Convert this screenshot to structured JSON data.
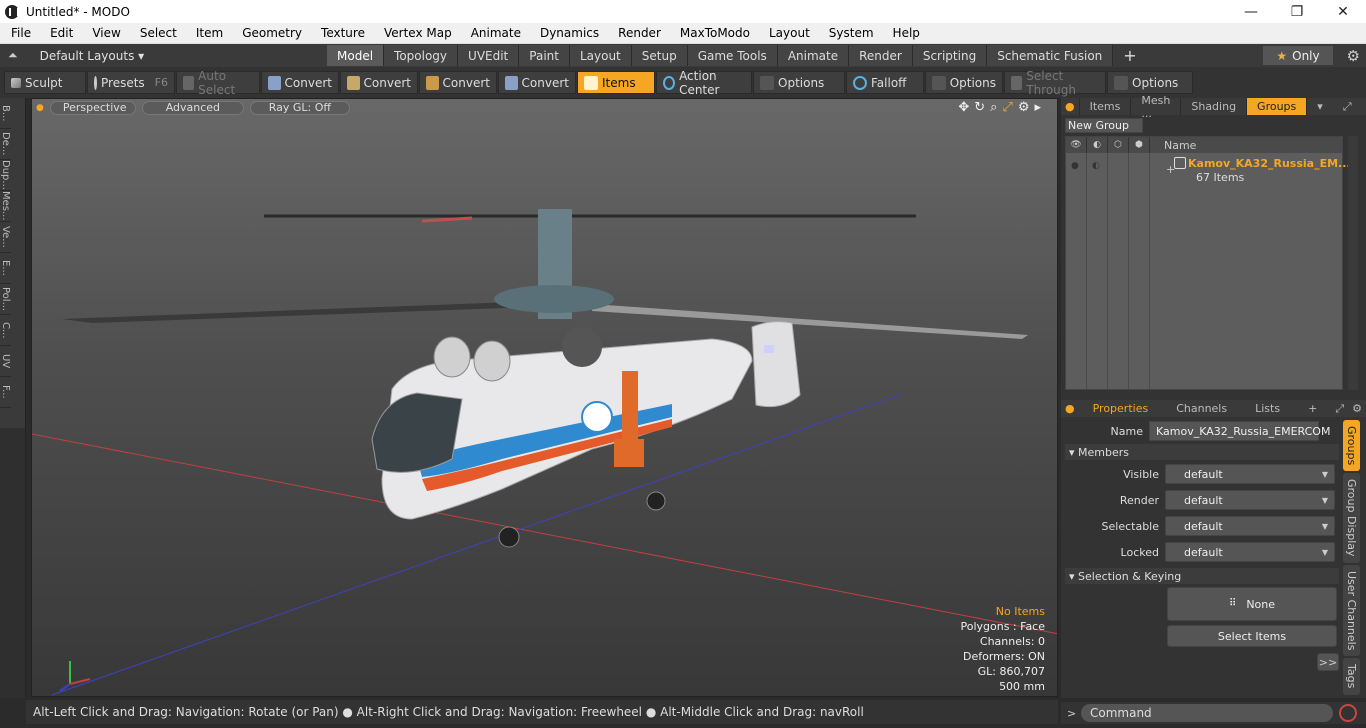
{
  "window": {
    "title": "Untitled* - MODO",
    "min": "—",
    "max": "❐",
    "close": "✕"
  },
  "menu": [
    "File",
    "Edit",
    "View",
    "Select",
    "Item",
    "Geometry",
    "Texture",
    "Vertex Map",
    "Animate",
    "Dynamics",
    "Render",
    "MaxToModo",
    "Layout",
    "System",
    "Help"
  ],
  "layout_bar": {
    "dropdown": "Default Layouts",
    "tabs": [
      "Model",
      "Topology",
      "UVEdit",
      "Paint",
      "Layout",
      "Setup",
      "Game Tools",
      "Animate",
      "Render",
      "Scripting",
      "Schematic Fusion"
    ],
    "active_tab": "Model",
    "add": "+",
    "only": "Only"
  },
  "toolbar": {
    "sculpt": "Sculpt",
    "presets": "Presets",
    "presets_key": "F6",
    "auto_select": "Auto Select",
    "convert1": "Convert",
    "convert2": "Convert",
    "convert3": "Convert",
    "convert4": "Convert",
    "items": "Items",
    "action_center": "Action Center",
    "options1": "Options",
    "falloff": "Falloff",
    "options2": "Options",
    "select_through": "Select Through",
    "options3": "Options"
  },
  "left_tools": [
    "B...",
    "De...",
    "Dup...",
    "Mes...",
    "Ve...",
    "E...",
    "Pol...",
    "C...",
    "UV",
    "F..."
  ],
  "viewport": {
    "view": "Perspective",
    "shading": "Advanced",
    "raygl": "Ray GL: Off",
    "stats": {
      "selection": "No Items",
      "polygons": "Polygons : Face",
      "channels": "Channels: 0",
      "deformers": "Deformers: ON",
      "gl": "GL: 860,707",
      "scale": "500 mm"
    }
  },
  "statusbar": "Alt-Left Click and Drag: Navigation: Rotate (or Pan) ● Alt-Right Click and Drag: Navigation: Freewheel ● Alt-Middle Click and Drag: navRoll",
  "groups_panel": {
    "tabs": [
      "Items",
      "Mesh ...",
      "Shading",
      "Groups"
    ],
    "active_tab": "Groups",
    "new_group": "New Group",
    "col_name": "Name",
    "group_name": "Kamov_KA32_Russia_EM...",
    "group_count": "67 Items"
  },
  "properties_panel": {
    "tabs": [
      "Properties",
      "Channels",
      "Lists",
      "+"
    ],
    "active_tab": "Properties",
    "name_label": "Name",
    "name_value": "Kamov_KA32_Russia_EMERCOM",
    "members_header": "Members",
    "visible_label": "Visible",
    "visible_value": "default",
    "render_label": "Render",
    "render_value": "default",
    "selectable_label": "Selectable",
    "selectable_value": "default",
    "locked_label": "Locked",
    "locked_value": "default",
    "selkey_header": "Selection & Keying",
    "none_btn": "None",
    "select_items_btn": "Select Items",
    "more_btn": ">>",
    "side_tabs": [
      "Groups",
      "Group Display",
      "User Channels",
      "Tags"
    ]
  },
  "command": {
    "placeholder": "Command"
  },
  "colors": {
    "accent": "#f5a623",
    "panel": "#333333",
    "viewport_top": "#686868"
  }
}
